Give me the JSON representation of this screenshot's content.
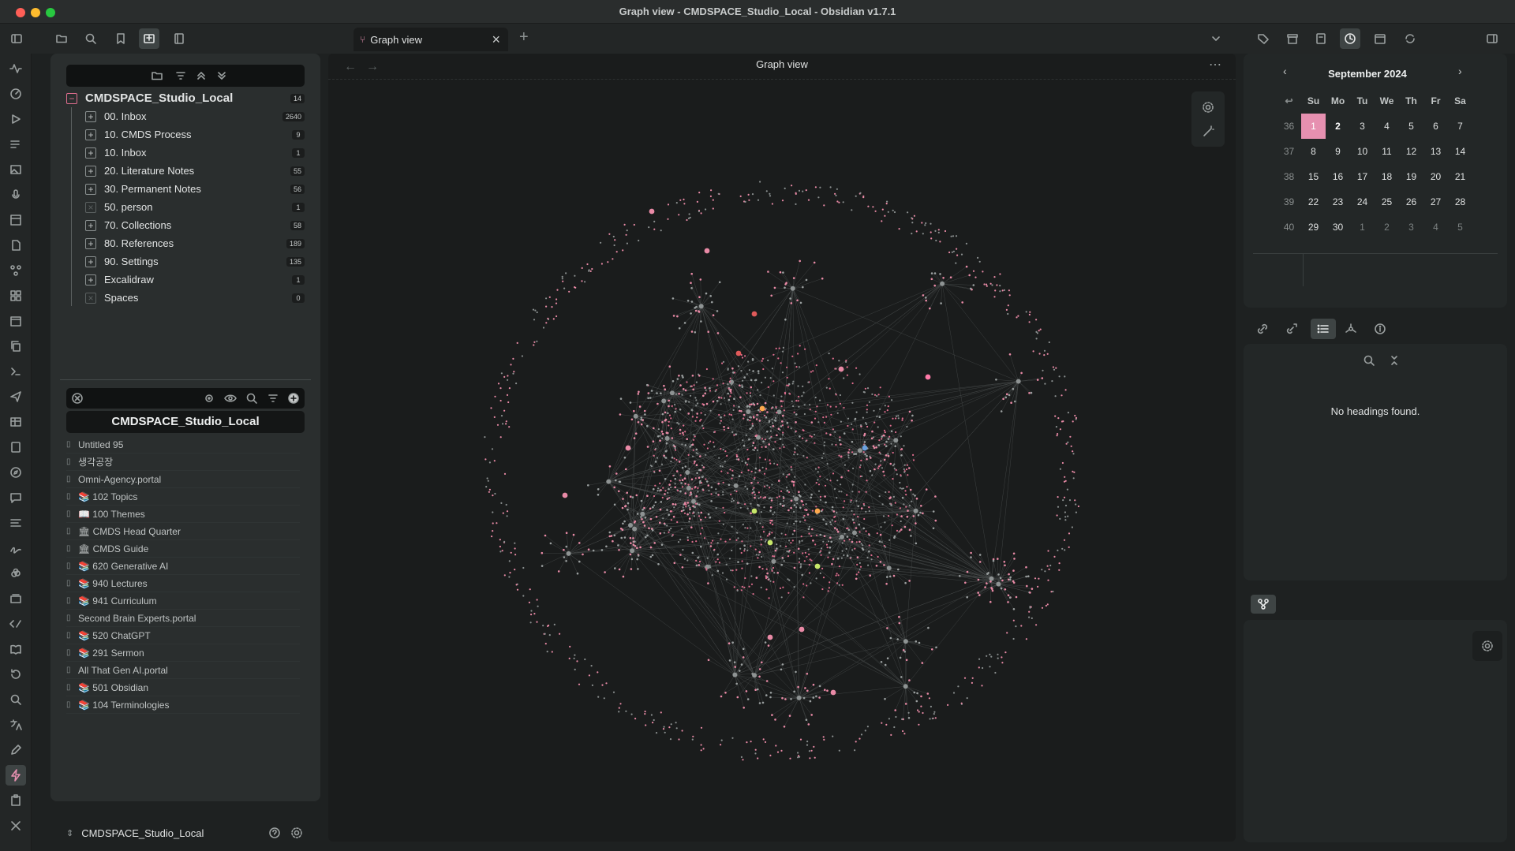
{
  "window": {
    "title": "Graph view - CMDSPACE_Studio_Local - Obsidian v1.7.1"
  },
  "tab": {
    "label": "Graph view",
    "close": "×",
    "new": "+"
  },
  "graph": {
    "header_title": "Graph view",
    "more": "⋯"
  },
  "explorer": {
    "root": {
      "label": "CMDSPACE_Studio_Local",
      "count": "14"
    },
    "folders": [
      {
        "label": "00. Inbox",
        "count": "2640",
        "kind": "plus"
      },
      {
        "label": "10. CMDS Process",
        "count": "9",
        "kind": "plus"
      },
      {
        "label": "10. Inbox",
        "count": "1",
        "kind": "plus"
      },
      {
        "label": "20. Literature Notes",
        "count": "55",
        "kind": "plus"
      },
      {
        "label": "30. Permanent Notes",
        "count": "56",
        "kind": "plus"
      },
      {
        "label": "50. person",
        "count": "1",
        "kind": "x"
      },
      {
        "label": "70. Collections",
        "count": "58",
        "kind": "plus"
      },
      {
        "label": "80. References",
        "count": "189",
        "kind": "plus"
      },
      {
        "label": "90. Settings",
        "count": "135",
        "kind": "plus"
      },
      {
        "label": "Excalidraw",
        "count": "1",
        "kind": "plus"
      },
      {
        "label": "Spaces",
        "count": "0",
        "kind": "x"
      }
    ]
  },
  "spaces": {
    "title": "CMDSPACE_Studio_Local",
    "items": [
      "Untitled 95",
      "생각공장",
      "Omni-Agency.portal",
      "📚 102 Topics",
      "📖 100 Themes",
      "🏛 CMDS Head Quarter",
      "🏛 CMDS Guide",
      "📚 620 Generative AI",
      "📚 940 Lectures",
      "📚 941 Curriculum",
      "Second Brain Experts.portal",
      "📚 520 ChatGPT",
      "📚 291 Sermon",
      "All That Gen AI.portal",
      "📚 501 Obsidian",
      "📚 104 Terminologies"
    ]
  },
  "vault": {
    "name": "CMDSPACE_Studio_Local"
  },
  "calendar": {
    "month": "September 2024",
    "weekdays": [
      "Su",
      "Mo",
      "Tu",
      "We",
      "Th",
      "Fr",
      "Sa"
    ],
    "weeks": [
      {
        "num": "36",
        "days": [
          "1",
          "2",
          "3",
          "4",
          "5",
          "6",
          "7"
        ]
      },
      {
        "num": "37",
        "days": [
          "8",
          "9",
          "10",
          "11",
          "12",
          "13",
          "14"
        ]
      },
      {
        "num": "38",
        "days": [
          "15",
          "16",
          "17",
          "18",
          "19",
          "20",
          "21"
        ]
      },
      {
        "num": "39",
        "days": [
          "22",
          "23",
          "24",
          "25",
          "26",
          "27",
          "28"
        ]
      },
      {
        "num": "40",
        "days": [
          "29",
          "30",
          "1",
          "2",
          "3",
          "4",
          "5"
        ]
      }
    ]
  },
  "outline": {
    "empty": "No headings found."
  },
  "colors": {
    "accent": "#e690b0",
    "bg": "#1e2121",
    "panel": "#2a2e2e"
  }
}
